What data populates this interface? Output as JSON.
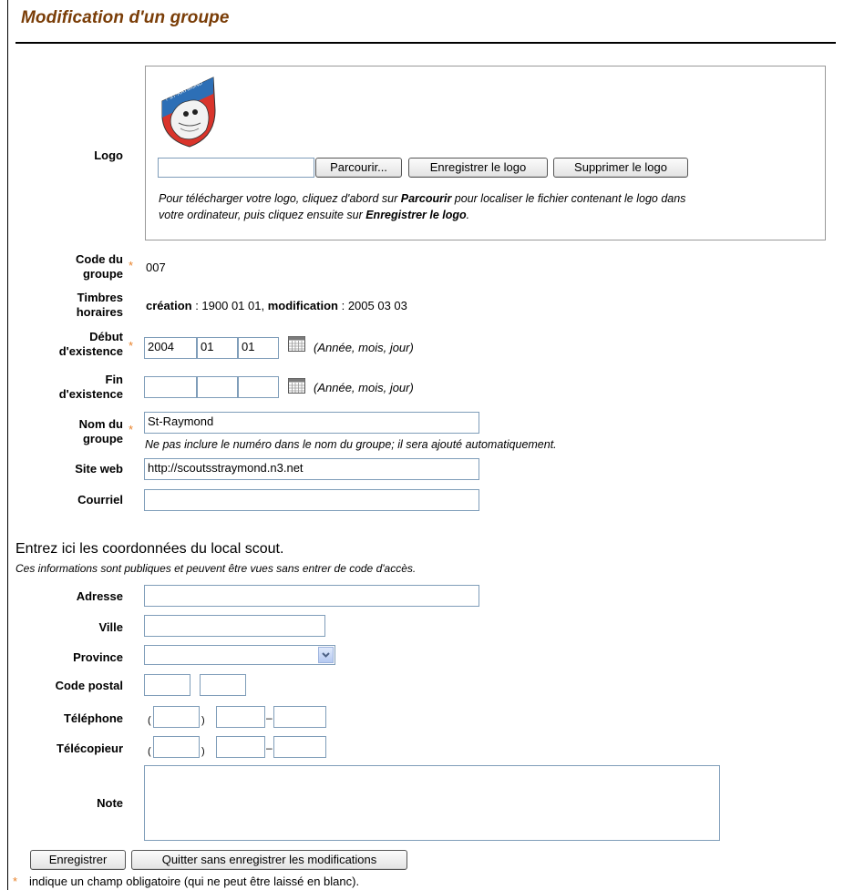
{
  "page": {
    "title": "Modification d'un groupe"
  },
  "logo": {
    "label": "Logo",
    "badge_text": "7 ST-RAYMOND",
    "file_value": "",
    "browse_label": "Parcourir...",
    "save_logo_label": "Enregistrer le logo",
    "delete_logo_label": "Supprimer le logo",
    "help_part1": "Pour télécharger votre logo, cliquez d'abord sur ",
    "help_bold1": "Parcourir",
    "help_part2": " pour localiser le fichier contenant le logo dans",
    "help_part3": "votre ordinateur, puis cliquez ensuite sur ",
    "help_bold2": "Enregistrer le logo",
    "help_part4": "."
  },
  "code": {
    "label_line1": "Code du",
    "label_line2": "groupe",
    "value": "007"
  },
  "timestamps": {
    "label_line1": "Timbres",
    "label_line2": "horaires",
    "creation_label": "création",
    "creation_value": " : 1900 01 01, ",
    "modification_label": "modification",
    "modification_value": " : 2005 03 03"
  },
  "start": {
    "label_line1": "Début",
    "label_line2": "d'existence",
    "year": "2004",
    "month": "01",
    "day": "01",
    "hint": "(Année, mois, jour)"
  },
  "end": {
    "label_line1": "Fin",
    "label_line2": "d'existence",
    "year": "",
    "month": "",
    "day": "",
    "hint": "(Année, mois, jour)"
  },
  "name": {
    "label_line1": "Nom du",
    "label_line2": "groupe",
    "value": "St-Raymond",
    "hint": "Ne pas inclure le numéro dans le nom du groupe; il sera ajouté automatiquement."
  },
  "website": {
    "label": "Site web",
    "value": "http://scoutsstraymond.n3.net"
  },
  "email": {
    "label": "Courriel",
    "value": ""
  },
  "local": {
    "heading": "Entrez ici les coordonnées du local scout.",
    "subheading": "Ces informations sont publiques et peuvent être vues sans entrer de code d'accès.",
    "address_label": "Adresse",
    "address_value": "",
    "city_label": "Ville",
    "city_value": "",
    "province_label": "Province",
    "province_value": "",
    "postal_label": "Code postal",
    "postal_part1": "",
    "postal_part2": "",
    "phone_label": "Téléphone",
    "phone_area": "",
    "phone_prefix": "",
    "phone_line": "",
    "fax_label": "Télécopieur",
    "fax_area": "",
    "fax_prefix": "",
    "fax_line": "",
    "note_label": "Note",
    "note_value": "",
    "open_paren": "(",
    "close_paren": ")",
    "dash": "–"
  },
  "actions": {
    "save_label": "Enregistrer",
    "quit_label": "Quitter sans enregistrer les modifications"
  },
  "footer": {
    "star": "*",
    "note": "indique un champ obligatoire (qui ne peut être laissé en blanc)."
  },
  "colors": {
    "title": "#7a3d07",
    "required": "#e8822a",
    "input_border": "#7f9db9"
  }
}
